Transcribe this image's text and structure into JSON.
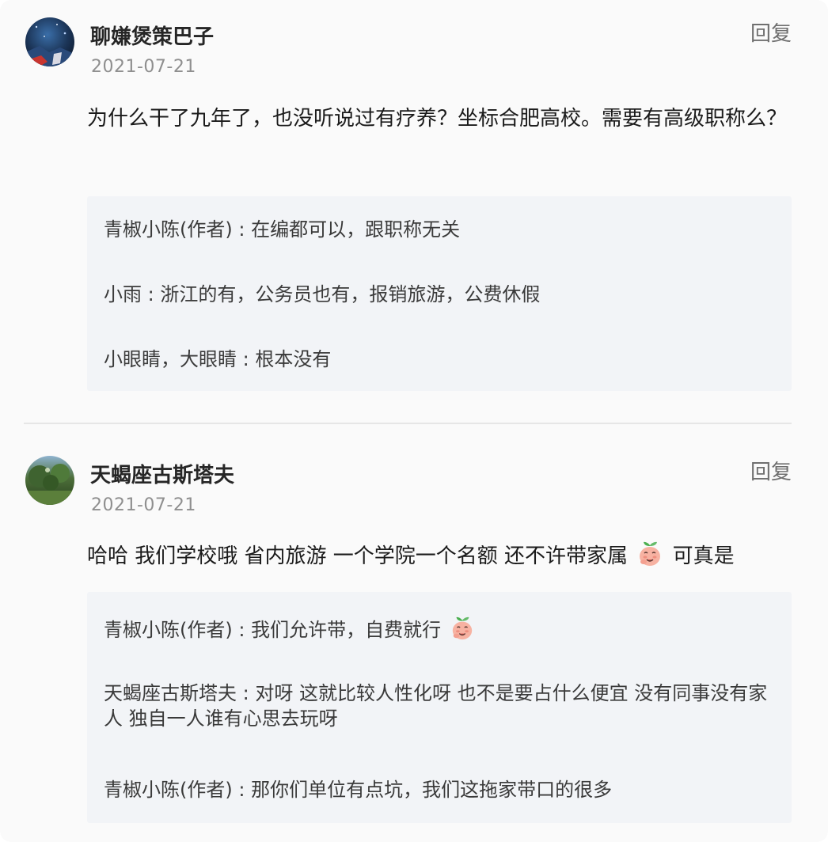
{
  "comments": [
    {
      "username": "聊嫌煲策巴子",
      "date": "2021-07-21",
      "reply_label": "回复",
      "text": "为什么干了九年了，也没听说过有疗养？坐标合肥高校。需要有高级职称么？",
      "replies": [
        {
          "text": "青椒小陈(作者) : 在编都可以，跟职称无关"
        },
        {
          "text": "小雨 : 浙江的有，公务员也有，报销旅游，公费休假"
        },
        {
          "text": "小眼睛，大眼睛 : 根本没有"
        }
      ]
    },
    {
      "username": "天蝎座古斯塔夫",
      "date": "2021-07-21",
      "reply_label": "回复",
      "text_before_emoji": "哈哈 我们学校哦 省内旅游 一个学院一个名额 还不许带家属",
      "text_after_emoji": "可真是",
      "replies": [
        {
          "text": "青椒小陈(作者) : 我们允许带，自费就行"
        },
        {
          "text": "天蝎座古斯塔夫 : 对呀 这就比较人性化呀 也不是要占什么便宜 没有同事没有家人 独自一人谁有心思去玩呀"
        },
        {
          "text": "青椒小陈(作者) : 那你们单位有点坑，我们这拖家带口的很多"
        }
      ]
    }
  ],
  "icons": {
    "emoji": "sprout-face-emoji-icon"
  },
  "colors": {
    "reply_box_bg": "#f2f4f7",
    "date_text": "#8f8f8f",
    "emoji_face": "#f7b2a2"
  }
}
